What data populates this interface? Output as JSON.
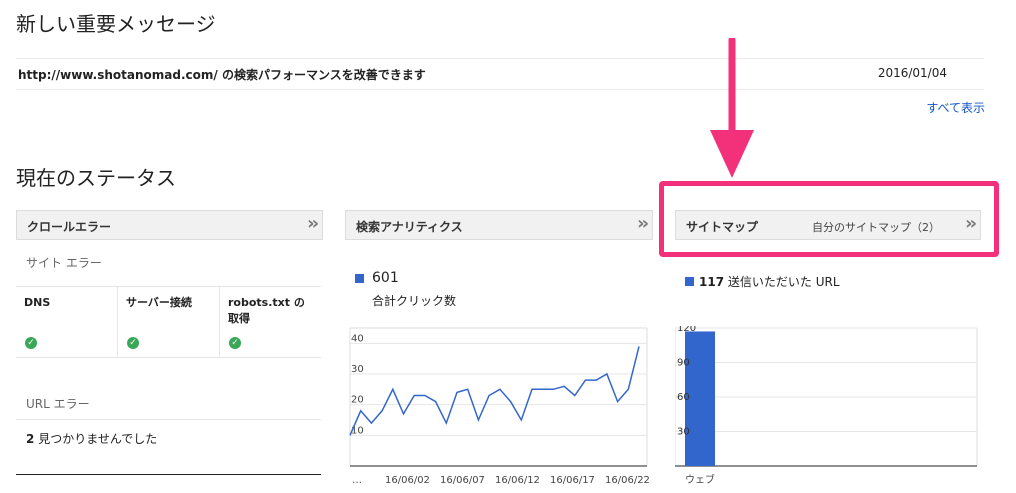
{
  "messages": {
    "title": "新しい重要メッセージ",
    "items": [
      {
        "text": "http://www.shotanomad.com/ の検索パフォーマンスを改善できます",
        "date": "2016/01/04"
      }
    ],
    "see_all": "すべて表示"
  },
  "status": {
    "title": "現在のステータス",
    "crawl": {
      "header": "クロールエラー",
      "site_errors_label": "サイト エラー",
      "columns": [
        "DNS",
        "サーバー接続",
        "robots.txt の取得"
      ],
      "url_errors_label": "URL エラー",
      "url_count": "2",
      "url_text": "見つかりませんでした"
    },
    "analytics": {
      "header": "検索アナリティクス",
      "value": "601",
      "label": "合計クリック数"
    },
    "sitemap": {
      "header": "サイトマップ",
      "sub": "自分のサイトマップ（2）",
      "count": "117",
      "legend": "送信いただいた URL"
    }
  },
  "colors": {
    "accent": "#3366cc",
    "highlight": "#f2317a",
    "ok": "#3aa757",
    "link": "#1155cc"
  },
  "chart_data": [
    {
      "type": "line",
      "series": [
        {
          "values": [
            10,
            18,
            14,
            18,
            25,
            17,
            23,
            23,
            21,
            14,
            24,
            25,
            15,
            23,
            25,
            21,
            15,
            25,
            25,
            25,
            26,
            23,
            28,
            28,
            30,
            21,
            25,
            39
          ]
        }
      ],
      "y_ticks": [
        "10",
        "20",
        "30",
        "40"
      ],
      "x_ticks": [
        "…",
        "16/06/02",
        "16/06/07",
        "16/06/12",
        "16/06/17",
        "16/06/22"
      ],
      "ylim": [
        0,
        45
      ],
      "grid": true
    },
    {
      "type": "bar",
      "categories": [
        "ウェブ"
      ],
      "values": [
        117
      ],
      "y_ticks": [
        "30",
        "60",
        "90",
        "120"
      ],
      "ylim": [
        0,
        120
      ],
      "grid": true
    }
  ]
}
